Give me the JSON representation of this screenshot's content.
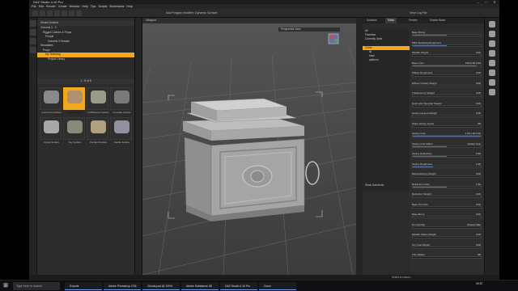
{
  "window": {
    "title": "DAZ Studio 4.10 Pro"
  },
  "menu": [
    "File",
    "Edit",
    "Render",
    "Create",
    "Window",
    "Help",
    "Tips",
    "Scripts",
    "Bookmarks",
    "Help"
  ],
  "toolbar": {
    "mid_label": "Add Polygon Modifier: Dynamic Surface",
    "right_label": "View Log File"
  },
  "content": {
    "header": "Smart Content",
    "tree": [
      {
        "label": "Genesis 3 - 3",
        "sel": false
      },
      {
        "label": "Rigged Clothes & Props",
        "sel": false
      },
      {
        "label": "People",
        "sel": false
      },
      {
        "label": "Genesis 3 Female",
        "sel": false
      },
      {
        "label": "Wearables",
        "sel": false
      },
      {
        "label": "Props",
        "sel": false
      },
      {
        "label": "My Texturing",
        "sel": true
      },
      {
        "label": "Project Library",
        "sel": false
      }
    ],
    "pager": "1 - 8 of 8",
    "thumbs": [
      {
        "label": "Automotive Surface",
        "sel": false
      },
      {
        "label": "Chest Surface",
        "sel": true
      },
      {
        "label": "Cobblestone Surface",
        "sel": false
      },
      {
        "label": "Compass Surface",
        "sel": false
      },
      {
        "label": "Crystal Surface",
        "sel": false
      },
      {
        "label": "Key Surface",
        "sel": false
      },
      {
        "label": "Pendant Surface",
        "sel": false
      },
      {
        "label": "Candle Surface",
        "sel": false
      }
    ]
  },
  "viewport": {
    "tab": "Viewport",
    "camera": "Perspective View"
  },
  "surfaces": {
    "tabs": [
      "Surfaces",
      "Editor",
      "Presets",
      "Shader Baker"
    ],
    "filters": [
      "All",
      "Favorites",
      "Currently Used"
    ],
    "tree": [
      {
        "label": "Chest",
        "sel": true
      },
      {
        "label": "lid",
        "sel": false
      },
      {
        "label": "base",
        "sel": false
      },
      {
        "label": "platform",
        "sel": false
      }
    ],
    "props": [
      {
        "label": "Base Mixing",
        "value": "",
        "fill": 0.5
      },
      {
        "label": "PBR Metallicity/Roughness",
        "value": "",
        "fill": 0.5
      },
      {
        "label": "Metallic Weight",
        "value": "0.00",
        "fill": 0.0
      },
      {
        "label": "Base Color",
        "value": "0.94  0.94  0.94",
        "fill": 0.94
      },
      {
        "label": "Diffuse Roughness",
        "value": "0.00",
        "fill": 0.0
      },
      {
        "label": "Diffuse Overlay Weight",
        "value": "0.00",
        "fill": 0.0
      },
      {
        "label": "Translucency Weight",
        "value": "0.00",
        "fill": 0.0
      },
      {
        "label": "Dual Lobe Specular Weight",
        "value": "0.00",
        "fill": 0.0
      },
      {
        "label": "Glossy Layered Weight",
        "value": "0.00",
        "fill": 0.0
      },
      {
        "label": "Share Glossy Inputs",
        "value": "Off",
        "fill": 0.0
      },
      {
        "label": "Glossy Color",
        "value": "1.00  1.00  1.00",
        "fill": 1.0
      },
      {
        "label": "Glossy Color Effect",
        "value": "Scatter Only",
        "fill": 0.5
      },
      {
        "label": "Glossy Reflectivity",
        "value": "0.50",
        "fill": 0.5
      },
      {
        "label": "Glossy Roughness",
        "value": "0.30",
        "fill": 0.3
      },
      {
        "label": "Backscattering Weight",
        "value": "0.00",
        "fill": 0.0
      },
      {
        "label": "Refraction Index",
        "value": "1.50",
        "fill": 0.5
      },
      {
        "label": "Refraction Weight",
        "value": "0.00",
        "fill": 0.0
      },
      {
        "label": "Base Thin Film",
        "value": "0.00",
        "fill": 0.0
      },
      {
        "label": "Base Bump",
        "value": "0.00",
        "fill": 0.0
      },
      {
        "label": "Normal Map",
        "value": "Choose Map",
        "fill": 0.0
      },
      {
        "label": "Metallic Flakes Weight",
        "value": "0.00",
        "fill": 0.0
      },
      {
        "label": "Top Coat Weight",
        "value": "0.00",
        "fill": 0.0
      },
      {
        "label": "Thin Walled",
        "value": "Off",
        "fill": 0.0
      }
    ],
    "show_sub_items": "Show Sub Items"
  },
  "status": {
    "text": "Select a Lesson..."
  },
  "taskbar": {
    "search": "Type here to search",
    "items": [
      "Exports",
      "Adobe Photoshop CS6",
      "Clouds.psd @ 100%",
      "Adobe Substance 3D",
      "DAZ Studio 4.10 Pro",
      "Zoom"
    ],
    "clock": "09:57"
  },
  "colors": {
    "accent": "#f2a81c",
    "panel": "#2b2b2b",
    "viewport_bg": "#4a4a4a"
  }
}
